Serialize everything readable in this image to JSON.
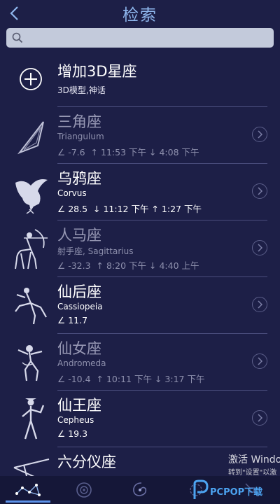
{
  "header": {
    "back_glyph": "<",
    "title": "检索"
  },
  "search": {
    "placeholder": "",
    "value": ""
  },
  "add_item": {
    "title": "增加3D星座",
    "subtitle": "3D模型,神话"
  },
  "constellations": [
    {
      "name": "三角座",
      "latin": "Triangulum",
      "altitude": "-7.6",
      "rise": "11:53 下午",
      "set": "4:08 下午",
      "visible": false
    },
    {
      "name": "乌鸦座",
      "latin": "Corvus",
      "altitude": "28.5",
      "rise": "11:12 下午",
      "set": "1:27 下午",
      "visible": true
    },
    {
      "name": "人马座",
      "latin": "射手座, Sagittarius",
      "altitude": "-32.3",
      "rise": "8:20 下午",
      "set": "4:40 上午",
      "visible": false
    },
    {
      "name": "仙后座",
      "latin": "Cassiopeia",
      "altitude": "11.7",
      "rise": "",
      "set": "",
      "visible": true
    },
    {
      "name": "仙女座",
      "latin": "Andromeda",
      "altitude": "-10.4",
      "rise": "10:11 下午",
      "set": "3:17 下午",
      "visible": false
    },
    {
      "name": "仙王座",
      "latin": "Cepheus",
      "altitude": "19.3",
      "rise": "",
      "set": "",
      "visible": true
    },
    {
      "name": "六分仪座",
      "latin": "",
      "altitude": "",
      "rise": "",
      "set": "",
      "visible": true
    }
  ],
  "bottom_tabs": [
    {
      "icon": "constellation-icon",
      "active": true
    },
    {
      "icon": "planet-icon",
      "active": false
    },
    {
      "icon": "galaxy-icon",
      "active": false
    },
    {
      "icon": "nebula-icon",
      "active": false
    },
    {
      "icon": "satellite-icon",
      "active": false
    }
  ],
  "overlay": {
    "watermark_line1": "激活 Windo",
    "watermark_line2": "转到\"设置\"以激",
    "logo_text": "PCPOP下载"
  },
  "colors": {
    "background": "#1d1f47",
    "accent": "#8fb7ee",
    "tab_indicator": "#5d93ea",
    "dim_text": "#9798b4"
  }
}
